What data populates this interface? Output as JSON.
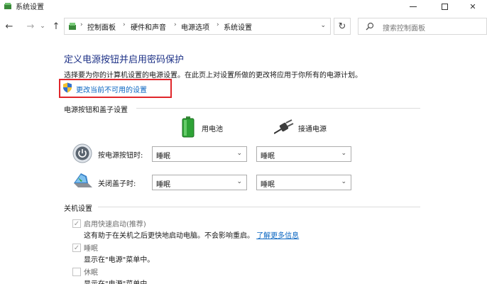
{
  "window": {
    "title": "系统设置"
  },
  "address": {
    "crumbs": [
      "控制面板",
      "硬件和声音",
      "电源选项",
      "系统设置"
    ],
    "search_placeholder": "搜索控制面板"
  },
  "page": {
    "title": "定义电源按钮并启用密码保护",
    "description": "选择要为你的计算机设置的电源设置。在此页上对设置所做的更改将应用于你所有的电源计划。",
    "change_link": "更改当前不可用的设置"
  },
  "power_buttons": {
    "group_label": "电源按钮和盖子设置",
    "col_battery": "用电池",
    "col_plugged": "接通电源",
    "rows": [
      {
        "label": "按电源按钮时:",
        "battery": "睡眠",
        "plugged": "睡眠"
      },
      {
        "label": "关闭盖子时:",
        "battery": "睡眠",
        "plugged": "睡眠"
      }
    ]
  },
  "shutdown": {
    "group_label": "关机设置",
    "items": [
      {
        "label": "启用快速启动(推荐)",
        "checked": true,
        "desc": "这有助于在关机之后更快地启动电脑。不会影响重启。",
        "link": "了解更多信息"
      },
      {
        "label": "睡眠",
        "checked": true,
        "desc": "显示在\"电源\"菜单中。"
      },
      {
        "label": "休眠",
        "checked": false,
        "desc": "显示在\"电源\"菜单中。"
      }
    ]
  }
}
